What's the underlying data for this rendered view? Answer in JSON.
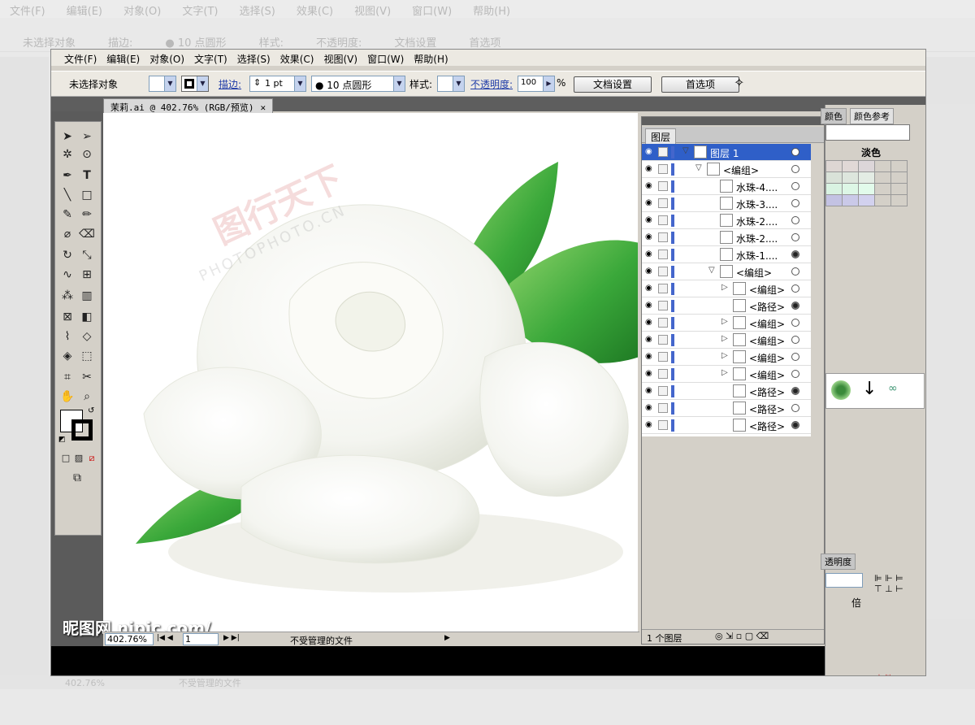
{
  "menu": [
    "文件(F)",
    "编辑(E)",
    "对象(O)",
    "文字(T)",
    "选择(S)",
    "效果(C)",
    "视图(V)",
    "窗口(W)",
    "帮助(H)"
  ],
  "control": {
    "selection": "未选择对象",
    "stroke_label": "描边:",
    "stroke_value": "1 pt",
    "brush": "● 10 点圆形",
    "style_label": "样式:",
    "opacity_label": "不透明度:",
    "opacity_value": "100",
    "percent": "%",
    "doc_settings": "文档设置",
    "preferences": "首选项"
  },
  "document_tab": "茉莉.ai @ 402.76% (RGB/预览)",
  "status": {
    "zoom": "402.76%",
    "page": "1",
    "message": "不受管理的文件"
  },
  "layers": {
    "tab": "图层",
    "count": "1 个图层",
    "rows": [
      {
        "name": "图层 1",
        "indent": 0,
        "toggle": "▽",
        "target": "open",
        "selected": true
      },
      {
        "name": "<编组>",
        "indent": 1,
        "toggle": "▽",
        "target": "open"
      },
      {
        "name": "水珠-4....",
        "indent": 2,
        "toggle": "",
        "target": "open"
      },
      {
        "name": "水珠-3....",
        "indent": 2,
        "toggle": "",
        "target": "open"
      },
      {
        "name": "水珠-2....",
        "indent": 2,
        "toggle": "",
        "target": "open"
      },
      {
        "name": "水珠-2....",
        "indent": 2,
        "toggle": "",
        "target": "open"
      },
      {
        "name": "水珠-1....",
        "indent": 2,
        "toggle": "",
        "target": "filled"
      },
      {
        "name": "<编组>",
        "indent": 2,
        "toggle": "▽",
        "target": "open"
      },
      {
        "name": "<编组>",
        "indent": 3,
        "toggle": "▷",
        "target": "open"
      },
      {
        "name": "<路径>",
        "indent": 3,
        "toggle": "",
        "target": "filled"
      },
      {
        "name": "<编组>",
        "indent": 3,
        "toggle": "▷",
        "target": "open"
      },
      {
        "name": "<编组>",
        "indent": 3,
        "toggle": "▷",
        "target": "open"
      },
      {
        "name": "<编组>",
        "indent": 3,
        "toggle": "▷",
        "target": "open"
      },
      {
        "name": "<编组>",
        "indent": 3,
        "toggle": "▷",
        "target": "open"
      },
      {
        "name": "<路径>",
        "indent": 3,
        "toggle": "",
        "target": "filled"
      },
      {
        "name": "<路径>",
        "indent": 3,
        "toggle": "",
        "target": "open"
      },
      {
        "name": "<路径>",
        "indent": 3,
        "toggle": "",
        "target": "filled"
      }
    ]
  },
  "right": {
    "color_tab": "颜色",
    "guide_tab": "颜色参考",
    "tint": "淡色",
    "opacity_tab": "透明度",
    "multiply": "倍",
    "brand": "中简"
  },
  "watermark": {
    "site": "昵图网 nipic.com/",
    "logo": "图行天下",
    "photo": "PHOTOPHOTO.CN"
  },
  "colors": {
    "leaf": "#3aa83a",
    "leaf_dark": "#1f7a24",
    "selection": "#2f5fc8"
  }
}
